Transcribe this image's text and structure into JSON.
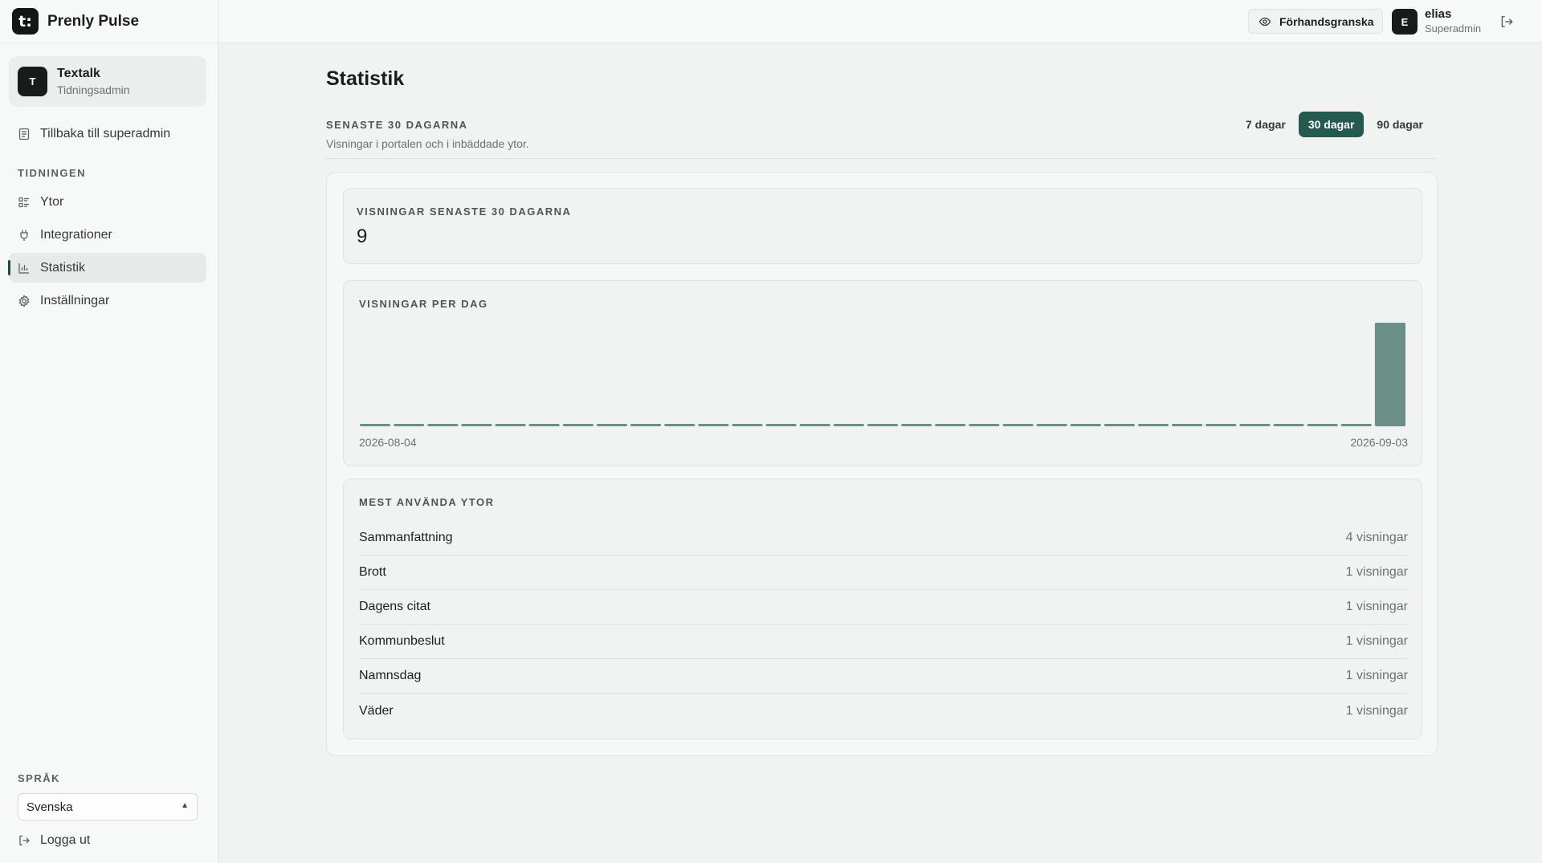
{
  "brand": {
    "logo_glyph": "t:",
    "name": "Prenly Pulse"
  },
  "org": {
    "avatar": "T",
    "name": "Textalk",
    "role": "Tidningsadmin"
  },
  "sidebar": {
    "back_label": "Tillbaka till superadmin",
    "section_label": "TIDNINGEN",
    "items": [
      {
        "label": "Ytor",
        "icon": "list-icon"
      },
      {
        "label": "Integrationer",
        "icon": "plug-icon"
      },
      {
        "label": "Statistik",
        "icon": "bar-chart-icon",
        "active": true
      },
      {
        "label": "Inställningar",
        "icon": "gear-icon"
      }
    ],
    "language_label": "SPRÅK",
    "language_value": "Svenska",
    "logout_label": "Logga ut"
  },
  "topbar": {
    "preview_label": "Förhandsgranska",
    "user_avatar": "E",
    "user_name": "elias",
    "user_role": "Superadmin"
  },
  "main": {
    "title": "Statistik",
    "range_label": "SENASTE 30 DAGARNA",
    "range_subtitle": "Visningar i portalen och i inbäddade ytor.",
    "range_tabs": [
      {
        "label": "7 dagar",
        "active": false
      },
      {
        "label": "30 dagar",
        "active": true
      },
      {
        "label": "90 dagar",
        "active": false
      }
    ],
    "kpi_label": "VISNINGAR SENASTE 30 DAGARNA",
    "kpi_value": "9",
    "chart_label": "VISNINGAR PER DAG",
    "top_label": "MEST ANVÄNDA YTOR",
    "top_items": [
      {
        "name": "Sammanfattning",
        "count": "4 visningar"
      },
      {
        "name": "Brott",
        "count": "1 visningar"
      },
      {
        "name": "Dagens citat",
        "count": "1 visningar"
      },
      {
        "name": "Kommunbeslut",
        "count": "1 visningar"
      },
      {
        "name": "Namnsdag",
        "count": "1 visningar"
      },
      {
        "name": "Väder",
        "count": "1 visningar"
      }
    ]
  },
  "colors": {
    "accent": "#255a50",
    "bar": "#6b8f86",
    "background": "#f0f3f2"
  },
  "chart_data": {
    "type": "bar",
    "title": "VISNINGAR PER DAG",
    "x_start": "2026-08-04",
    "x_end": "2026-09-03",
    "tick_labels": [
      "2026-08-04",
      "2026-09-03"
    ],
    "values": [
      0,
      0,
      0,
      0,
      0,
      0,
      0,
      0,
      0,
      0,
      0,
      0,
      0,
      0,
      0,
      0,
      0,
      0,
      0,
      0,
      0,
      0,
      0,
      0,
      0,
      0,
      0,
      0,
      0,
      0,
      9
    ],
    "ylim": [
      0,
      9
    ],
    "grid": false
  }
}
